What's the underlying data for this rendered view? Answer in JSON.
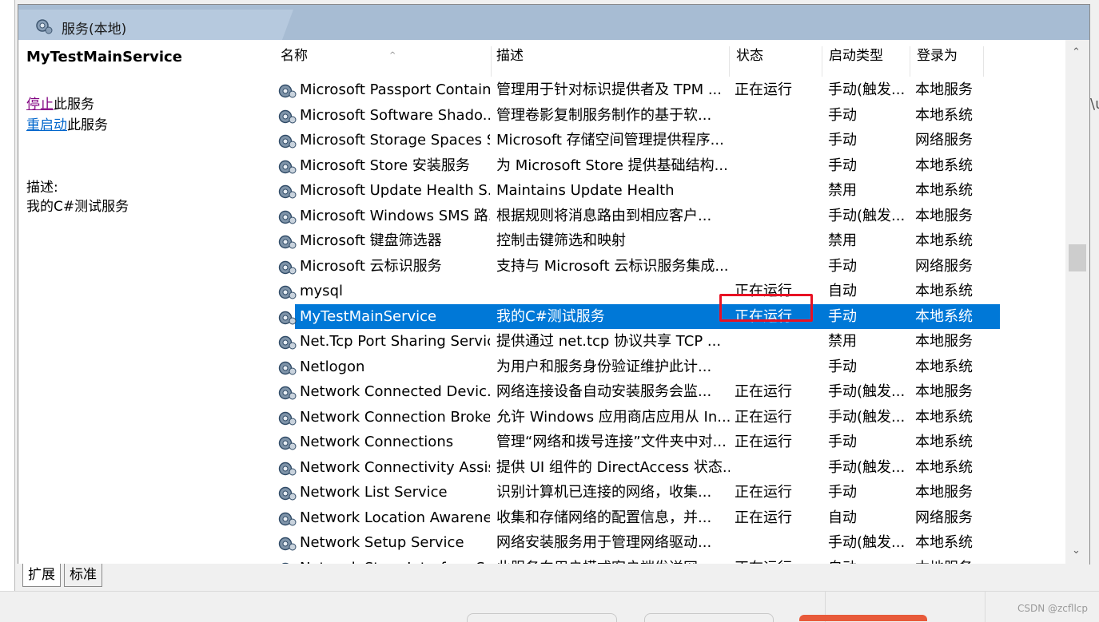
{
  "window": {
    "title": "服务(本地)"
  },
  "left_panel": {
    "service_name": "MyTestMainService",
    "stop_link": "停止",
    "stop_suffix": "此服务",
    "restart_link": "重启动",
    "restart_suffix": "此服务",
    "desc_label": "描述:",
    "desc_text": "我的C#测试服务"
  },
  "columns": {
    "name": "名称",
    "desc": "描述",
    "status": "状态",
    "start_type": "启动类型",
    "login": "登录为"
  },
  "services": [
    {
      "name": "Microsoft Passport Container",
      "desc": "管理用于针对标识提供者及 TPM ...",
      "status": "正在运行",
      "type": "手动(触发...",
      "login": "本地服务"
    },
    {
      "name": "Microsoft Software Shado...",
      "desc": "管理卷影复制服务制作的基于软...",
      "status": "",
      "type": "手动",
      "login": "本地系统"
    },
    {
      "name": "Microsoft Storage Spaces S...",
      "desc": "Microsoft 存储空间管理提供程序...",
      "status": "",
      "type": "手动",
      "login": "网络服务"
    },
    {
      "name": "Microsoft Store 安装服务",
      "desc": "为 Microsoft Store 提供基础结构...",
      "status": "",
      "type": "手动",
      "login": "本地系统"
    },
    {
      "name": "Microsoft Update Health S...",
      "desc": "Maintains Update Health",
      "status": "",
      "type": "禁用",
      "login": "本地系统"
    },
    {
      "name": "Microsoft Windows SMS 路...",
      "desc": "根据规则将消息路由到相应客户...",
      "status": "",
      "type": "手动(触发...",
      "login": "本地服务"
    },
    {
      "name": "Microsoft 键盘筛选器",
      "desc": "控制击键筛选和映射",
      "status": "",
      "type": "禁用",
      "login": "本地系统"
    },
    {
      "name": "Microsoft 云标识服务",
      "desc": "支持与 Microsoft 云标识服务集成...",
      "status": "",
      "type": "手动",
      "login": "网络服务"
    },
    {
      "name": "mysql",
      "desc": "",
      "status": "正在运行",
      "type": "自动",
      "login": "本地系统"
    },
    {
      "name": "MyTestMainService",
      "desc": "我的C#测试服务",
      "status": "正在运行",
      "type": "手动",
      "login": "本地系统"
    },
    {
      "name": "Net.Tcp Port Sharing Service",
      "desc": "提供通过 net.tcp 协议共享 TCP ...",
      "status": "",
      "type": "禁用",
      "login": "本地服务"
    },
    {
      "name": "Netlogon",
      "desc": "为用户和服务身份验证维护此计...",
      "status": "",
      "type": "手动",
      "login": "本地系统"
    },
    {
      "name": "Network Connected Devic...",
      "desc": "网络连接设备自动安装服务会监...",
      "status": "正在运行",
      "type": "手动(触发...",
      "login": "本地服务"
    },
    {
      "name": "Network Connection Broker",
      "desc": "允许 Windows 应用商店应用从 In...",
      "status": "正在运行",
      "type": "手动(触发...",
      "login": "本地系统"
    },
    {
      "name": "Network Connections",
      "desc": "管理“网络和拨号连接”文件夹中对...",
      "status": "正在运行",
      "type": "手动",
      "login": "本地系统"
    },
    {
      "name": "Network Connectivity Assis...",
      "desc": "提供 UI 组件的 DirectAccess 状态...",
      "status": "",
      "type": "手动(触发...",
      "login": "本地系统"
    },
    {
      "name": "Network List Service",
      "desc": "识别计算机已连接的网络，收集...",
      "status": "正在运行",
      "type": "手动",
      "login": "本地服务"
    },
    {
      "name": "Network Location Awarene...",
      "desc": "收集和存储网络的配置信息，并...",
      "status": "正在运行",
      "type": "自动",
      "login": "网络服务"
    },
    {
      "name": "Network Setup Service",
      "desc": "网络安装服务用于管理网络驱动...",
      "status": "",
      "type": "手动(触发...",
      "login": "本地系统"
    },
    {
      "name": "Network Store Interface Se...",
      "desc": "此服务向用户模式客户端发送网...",
      "status": "正在运行",
      "type": "自动",
      "login": "本地服务"
    }
  ],
  "selected_index": 9,
  "tabs": {
    "extended": "扩展",
    "standard": "标准"
  },
  "watermark": "CSDN @zcfllcp",
  "colors": {
    "selection": "#0078d7",
    "highlight_box": "#e81123",
    "header": "#a7bcd3"
  }
}
